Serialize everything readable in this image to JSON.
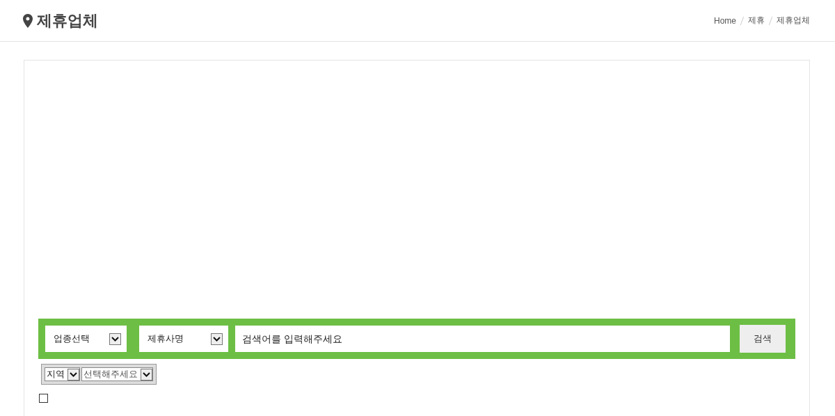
{
  "header": {
    "title": "제휴업체",
    "breadcrumb": [
      {
        "label": "Home"
      },
      {
        "label": "제휴"
      },
      {
        "label": "제휴업체"
      }
    ]
  },
  "search_bar": {
    "category_select": {
      "value": "업종선택"
    },
    "field_select": {
      "value": "제휴사명"
    },
    "search_field": {
      "placeholder": "검색어를 입력해주세요"
    },
    "search_button": "검색"
  },
  "region_filter": {
    "selects": [
      {
        "value": "지역"
      },
      {
        "value": "선택해주세요"
      }
    ]
  },
  "checkbox": {
    "checked": false
  }
}
